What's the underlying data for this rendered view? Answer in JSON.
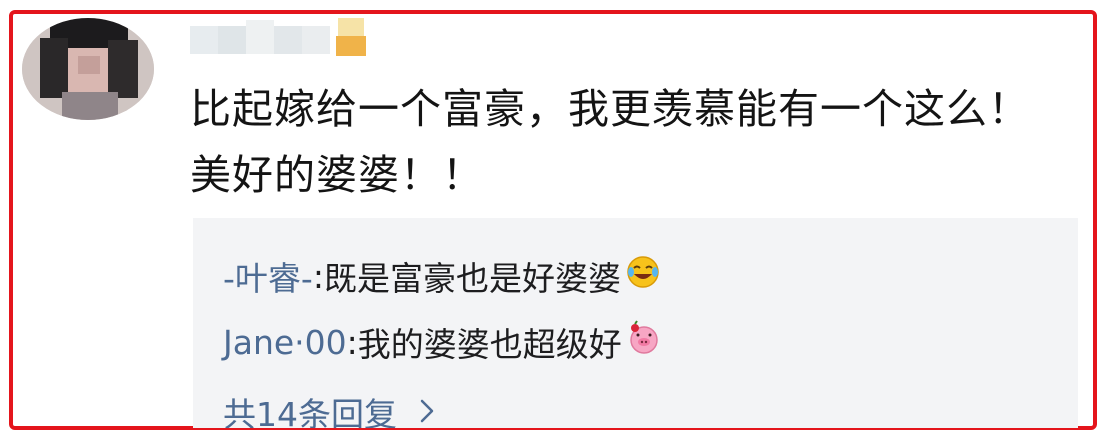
{
  "comment": {
    "text": "比起嫁给一个富豪，我更羡慕能有一个这么！美好的婆婆！！"
  },
  "replies": [
    {
      "name": "-叶睿-",
      "separator": ": ",
      "text": "既是富豪也是好婆婆",
      "emoji": "laughing-crying-emoji"
    },
    {
      "name": "Jane·00",
      "separator": ": ",
      "text": "我的婆婆也超级好",
      "emoji": "pig-emoji"
    }
  ],
  "more_replies": {
    "label": "共14条回复"
  },
  "colors": {
    "frame": "#e4151c",
    "link": "#4d6b93",
    "reply_bg": "#f3f4f6",
    "text": "#141414"
  }
}
